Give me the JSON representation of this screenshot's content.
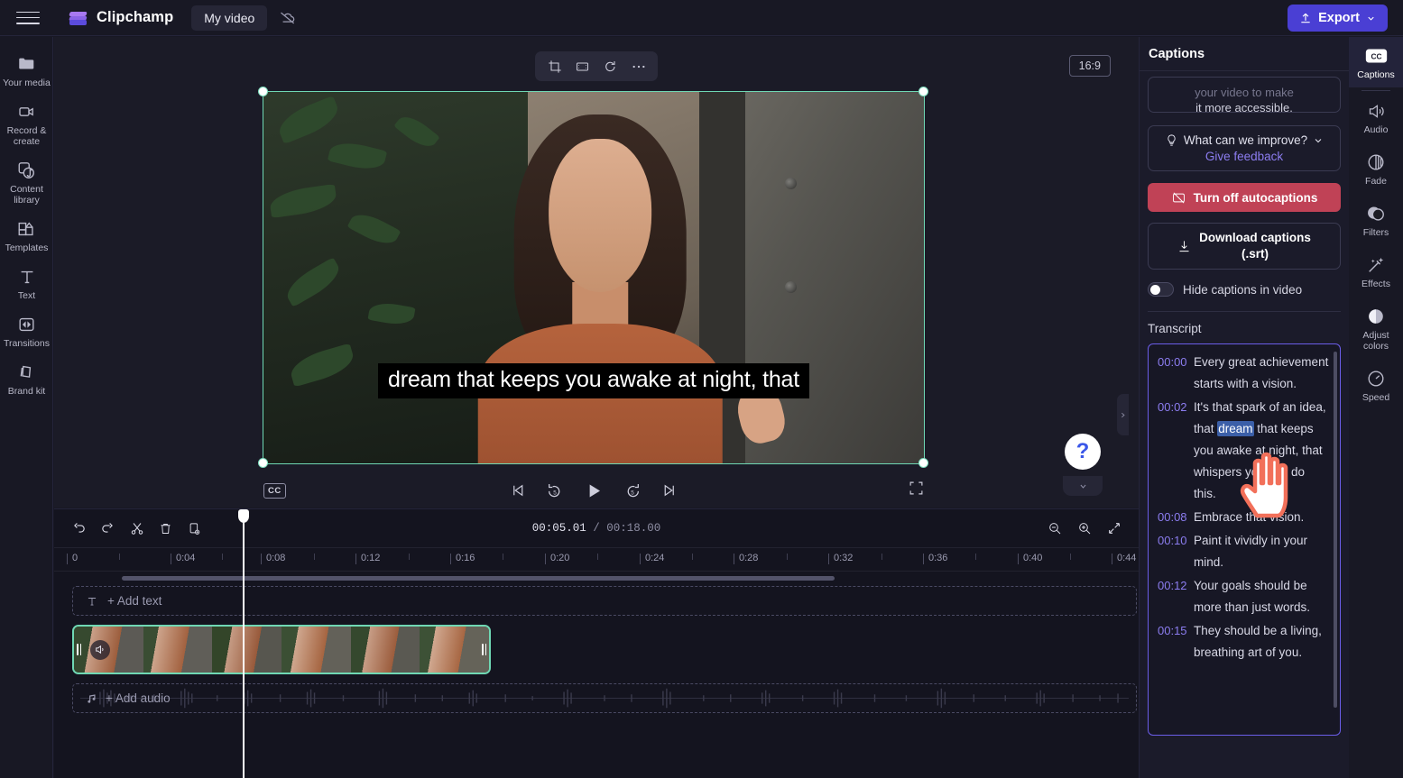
{
  "app": {
    "brand_name": "Clipchamp",
    "project_name": "My video",
    "export_label": "Export"
  },
  "left_rail": {
    "items": [
      {
        "label": "Your media",
        "icon": "folder-icon"
      },
      {
        "label": "Record & create",
        "icon": "video-camera-icon"
      },
      {
        "label": "Content library",
        "icon": "content-library-icon"
      },
      {
        "label": "Templates",
        "icon": "templates-icon"
      },
      {
        "label": "Text",
        "icon": "text-icon"
      },
      {
        "label": "Transitions",
        "icon": "transitions-icon"
      },
      {
        "label": "Brand kit",
        "icon": "brand-kit-icon"
      }
    ]
  },
  "preview": {
    "aspect_ratio": "16:9",
    "caption_text": "dream that keeps you awake at night, that",
    "cc_label": "CC",
    "toolbar": [
      {
        "name": "crop-icon"
      },
      {
        "name": "fit-icon"
      },
      {
        "name": "rotate-icon"
      },
      {
        "name": "more-options-icon"
      }
    ],
    "help_label": "?"
  },
  "captions_panel": {
    "title": "Captions",
    "intro_line_1": "your video to make",
    "intro_line_2": "it more accessible.",
    "feedback_question": "What can we improve?",
    "feedback_link": "Give feedback",
    "turn_off_label": "Turn off autocaptions",
    "download_label_1": "Download captions",
    "download_label_2": "(.srt)",
    "hide_captions_label": "Hide captions in video",
    "hide_captions_on": false,
    "transcript_title": "Transcript",
    "transcript": [
      {
        "time": "00:00",
        "text": "Every great achievement starts with a vision."
      },
      {
        "time": "00:02",
        "text_before": "It's that spark of an idea, that ",
        "selected": "dream",
        "text_after": " that keeps you awake at night, that whispers you can do this."
      },
      {
        "time": "00:08",
        "text": "Embrace that vision."
      },
      {
        "time": "00:10",
        "text": "Paint it vividly in your mind."
      },
      {
        "time": "00:12",
        "text": "Your goals should be more than just words."
      },
      {
        "time": "00:15",
        "text": "They should be a living, breathing art of you."
      }
    ]
  },
  "far_rail": {
    "active": {
      "label": "Captions",
      "icon": "cc-icon"
    },
    "items": [
      {
        "label": "Audio",
        "icon": "speaker-icon"
      },
      {
        "label": "Fade",
        "icon": "fade-icon"
      },
      {
        "label": "Filters",
        "icon": "filters-icon"
      },
      {
        "label": "Effects",
        "icon": "magic-wand-icon"
      },
      {
        "label": "Adjust colors",
        "icon": "contrast-icon"
      },
      {
        "label": "Speed",
        "icon": "speedometer-icon"
      }
    ]
  },
  "timeline": {
    "current_time": "00:05.01",
    "total_time": "/ 00:18.00",
    "tools": [
      {
        "name": "undo-icon"
      },
      {
        "name": "redo-icon"
      },
      {
        "name": "split-icon"
      },
      {
        "name": "delete-icon"
      },
      {
        "name": "duplicate-icon"
      }
    ],
    "zoom_tools": [
      {
        "name": "zoom-out-icon"
      },
      {
        "name": "zoom-in-icon"
      },
      {
        "name": "fit-timeline-icon"
      }
    ],
    "ruler_ticks": [
      "0",
      "0:04",
      "0:08",
      "0:12",
      "0:16",
      "0:20",
      "0:24",
      "0:28",
      "0:32",
      "0:36",
      "0:40",
      "0:44"
    ],
    "add_text_label": "+ Add text",
    "add_audio_label": "+ Add audio"
  },
  "colors": {
    "accent_purple": "#4a3fd4",
    "danger_red": "#c04256",
    "clip_green": "#6fd8b4",
    "link_purple": "#8c7df0",
    "selection_blue": "#3b5fa8"
  }
}
